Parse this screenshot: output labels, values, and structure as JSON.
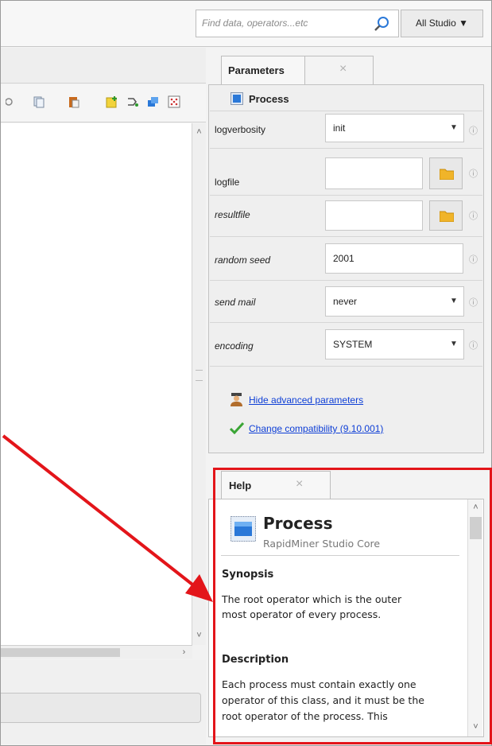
{
  "topbar": {
    "search_placeholder": "Find data, operators...etc",
    "scope_button": "All Studio ▼"
  },
  "parameters": {
    "tab_label": "Parameters",
    "close_glyph": "×",
    "operator_name": "Process",
    "rows": [
      {
        "label": "logverbosity",
        "value": "init",
        "kind": "select",
        "italic": false
      },
      {
        "label": "logfile",
        "value": "",
        "kind": "file",
        "italic": false
      },
      {
        "label": "resultfile",
        "value": "",
        "kind": "file",
        "italic": true
      },
      {
        "label": "random seed",
        "value": "2001",
        "kind": "text",
        "italic": true
      },
      {
        "label": "send mail",
        "value": "never",
        "kind": "select",
        "italic": true
      },
      {
        "label": "encoding",
        "value": "SYSTEM",
        "kind": "select",
        "italic": true
      }
    ],
    "hide_advanced_link": "Hide advanced parameters",
    "compatibility_link": "Change compatibility (9.10.001)"
  },
  "help": {
    "tab_label": "Help",
    "close_glyph": "×",
    "title": "Process",
    "subtitle": "RapidMiner Studio Core",
    "synopsis_heading": "Synopsis",
    "synopsis_line1": "The root operator which is the outer",
    "synopsis_line2": "most operator of every process.",
    "description_heading": "Description",
    "description_line1": "Each process must contain exactly one",
    "description_line2": "operator of this class, and it must be the",
    "description_line3": "root operator of the process. This"
  },
  "colors": {
    "annotation": "#e3151a",
    "link": "#0d3ed6",
    "accent_blue": "#2a78d8"
  },
  "icons": [
    "search-icon",
    "folder-icon",
    "process-icon",
    "info-icon",
    "user-icon",
    "check-icon"
  ]
}
